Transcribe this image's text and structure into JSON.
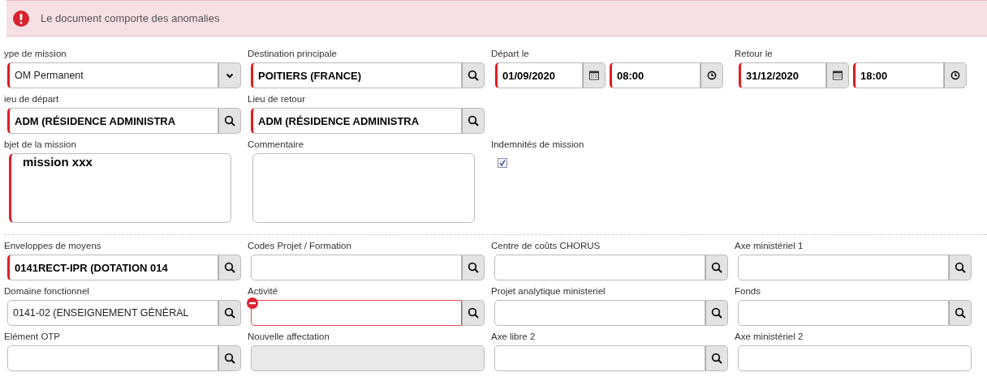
{
  "alert": {
    "text": "Le document comporte des anomalies"
  },
  "sections": [
    {
      "rows": [
        [
          {
            "label": "ype de mission",
            "kind": "select",
            "value": "OM Permanent",
            "bold": false,
            "invalid": true
          },
          {
            "label": "Destination principale",
            "kind": "lookup",
            "value": "POITIERS (FRANCE)",
            "bold": true,
            "invalid": true
          },
          {
            "label": "Départ le",
            "kind": "datetime",
            "parts": [
              {
                "kind": "date",
                "value": "01/09/2020",
                "invalid": true
              },
              {
                "kind": "time",
                "value": "08:00",
                "invalid": true
              }
            ]
          },
          {
            "label": "Retour le",
            "kind": "datetime",
            "parts": [
              {
                "kind": "date",
                "value": "31/12/2020",
                "invalid": true
              },
              {
                "kind": "time",
                "value": "18:00",
                "invalid": true
              }
            ]
          }
        ],
        [
          {
            "label": "ieu de départ",
            "kind": "lookup",
            "value": "ADM (RÉSIDENCE ADMINISTRA",
            "bold": true,
            "invalid": true
          },
          {
            "label": "Lieu de retour",
            "kind": "lookup",
            "value": "ADM (RÉSIDENCE ADMINISTRA",
            "bold": true,
            "invalid": true
          }
        ],
        [
          {
            "label": "bjet de la mission",
            "kind": "textarea",
            "value": "mission xxx",
            "bold": true,
            "invalid": true
          },
          {
            "label": "Commentaire",
            "kind": "textarea",
            "invalid": false
          },
          {
            "label": "Indemnités de mission",
            "kind": "checkbox",
            "checked": true
          }
        ]
      ]
    },
    {
      "rows": [
        [
          {
            "label": "Enveloppes de moyens",
            "kind": "lookup",
            "value": "0141RECT-IPR (DOTATION 014",
            "bold": true,
            "invalid": true
          },
          {
            "label": "Codes Projet / Formation",
            "kind": "lookup",
            "invalid": false
          },
          {
            "label": "Centre de coûts CHORUS",
            "kind": "lookup",
            "invalid": false
          },
          {
            "label": "Axe ministériel 1",
            "kind": "lookup",
            "invalid": false
          }
        ],
        [
          {
            "label": "Domaine fonctionnel",
            "kind": "lookup",
            "value": "0141-02 (ENSEIGNEMENT GÉNÉRAL",
            "bold": false,
            "invalid": false
          },
          {
            "label": "Activité",
            "kind": "lookup",
            "invalid": false,
            "error": true
          },
          {
            "label": "Projet analytique ministeriel",
            "kind": "lookup",
            "invalid": false
          },
          {
            "label": "Fonds",
            "kind": "lookup",
            "invalid": false
          }
        ],
        [
          {
            "label": "Elément OTP",
            "kind": "lookup",
            "invalid": false
          },
          {
            "label": "Nouvelle affectation",
            "kind": "text",
            "disabled": true,
            "invalid": false
          },
          {
            "label": "Axe libre 2",
            "kind": "lookup",
            "invalid": false
          },
          {
            "label": "Axe ministériel 2",
            "kind": "text",
            "invalid": false
          }
        ]
      ]
    }
  ]
}
